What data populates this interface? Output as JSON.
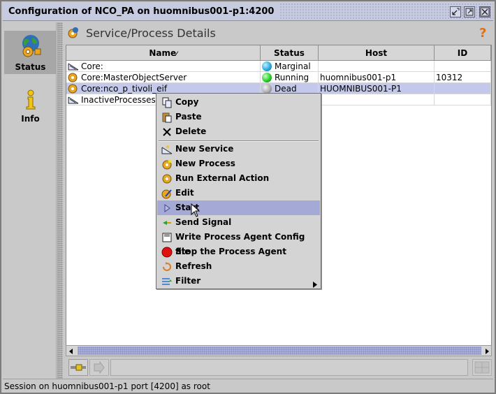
{
  "window": {
    "title": "Configuration of NCO_PA on huomnibus001-p1:4200",
    "controls": [
      "minimize-icon",
      "maximize-icon",
      "close-icon"
    ]
  },
  "nav": {
    "items": [
      {
        "label": "Status",
        "icon": "globe-gear-icon",
        "active": true
      },
      {
        "label": "Info",
        "icon": "info-icon",
        "active": false
      }
    ]
  },
  "main": {
    "title": "Service/Process Details",
    "help_icon": "help-icon"
  },
  "table": {
    "columns": [
      "Name",
      "Status",
      "Host",
      "ID"
    ],
    "name_sort_mark": "⁄",
    "rows": [
      {
        "name": "Core:",
        "status": "Marginal",
        "status_color": "#21a4d8",
        "host": "",
        "id": "",
        "icon": "service-icon"
      },
      {
        "name": "Core:MasterObjectServer",
        "status": "Running",
        "status_color": "#1ec81e",
        "host": "huomnibus001-p1",
        "id": "10312",
        "icon": "process-gear-icon"
      },
      {
        "name": "Core:nco_p_tivoli_eif",
        "status": "Dead",
        "status_color": "#a8a8a8",
        "host": "HUOMNIBUS001-P1",
        "id": "",
        "icon": "process-gear-icon"
      },
      {
        "name": "InactiveProcesses:",
        "status": "",
        "status_color": "",
        "host": "",
        "id": "",
        "icon": "service-icon"
      }
    ]
  },
  "context_menu": {
    "items": [
      {
        "label": "Copy",
        "icon": "copy-icon"
      },
      {
        "label": "Paste",
        "icon": "paste-icon"
      },
      {
        "label": "Delete",
        "icon": "delete-icon"
      },
      {
        "label": "New Service",
        "icon": "new-service-icon"
      },
      {
        "label": "New Process",
        "icon": "new-process-icon"
      },
      {
        "label": "Run External Action",
        "icon": "run-action-icon"
      },
      {
        "label": "Edit",
        "icon": "edit-icon"
      },
      {
        "label": "Start",
        "icon": "start-icon"
      },
      {
        "label": "Send Signal",
        "icon": "send-signal-icon"
      },
      {
        "label": "Write Process Agent Config file",
        "icon": "write-config-icon"
      },
      {
        "label": "Stop the Process Agent",
        "icon": "stop-icon"
      },
      {
        "label": "Refresh",
        "icon": "refresh-icon"
      },
      {
        "label": "Filter",
        "icon": "filter-icon"
      }
    ],
    "highlighted": "Start"
  },
  "status_bar": {
    "text": "Session on huomnibus001-p1 port [4200] as root"
  }
}
